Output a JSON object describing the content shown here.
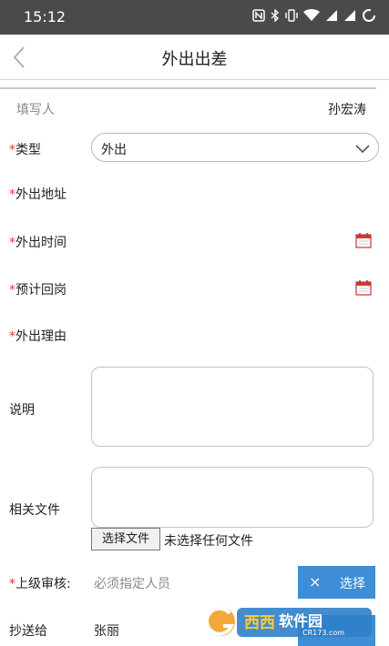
{
  "status_bar": {
    "time": "15:12",
    "icons": [
      "nfc-icon",
      "bluetooth-icon",
      "vibrate-icon",
      "wifi-icon",
      "signal-icon",
      "signal-icon",
      "battery-icon"
    ]
  },
  "nav": {
    "title": "外出出差"
  },
  "form": {
    "filler_label": "填写人",
    "filler_value": "孙宏涛",
    "type_label": "类型",
    "type_value": "外出",
    "address_label": "外出地址",
    "out_time_label": "外出时间",
    "return_label": "预计回岗",
    "reason_label": "外出理由",
    "description_label": "说明",
    "files_label": "相关文件",
    "file_button": "选择文件",
    "file_status": "未选择任何文件",
    "approver_label": "上级审核:",
    "approver_placeholder": "必须指定人员",
    "select_button_x": "×",
    "select_button_label": "选择",
    "cc_label": "抄送给",
    "cc_value": "张丽"
  },
  "required_marker": "*",
  "watermark": {
    "brand": "西西软件园",
    "url": "CR173.com"
  },
  "colors": {
    "status_bar": "#4a4a4a",
    "required": "#e33333",
    "accent": "#3d8ed6"
  }
}
